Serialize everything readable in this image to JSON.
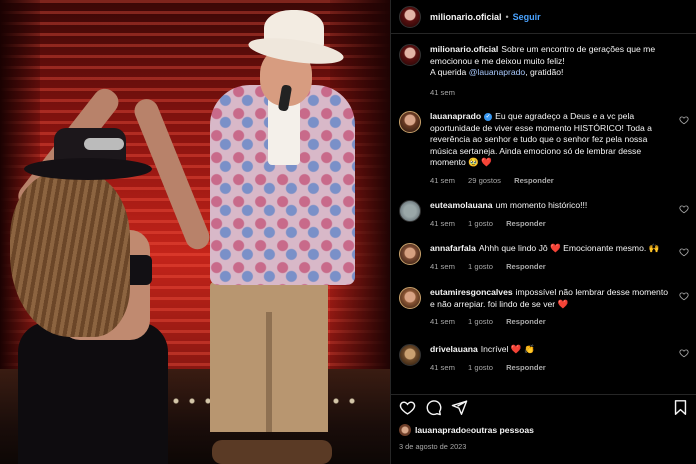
{
  "post": {
    "author": "milionario.oficial",
    "separator": "•",
    "follow_label": "Seguir",
    "caption_user": "milionario.oficial",
    "caption_text": "Sobre um encontro de gerações que me emocionou e me deixou muito feliz!",
    "caption_line2_prefix": "A querida ",
    "caption_mention": "@lauanaprado",
    "caption_line2_suffix": ", gratidão!",
    "caption_time": "41 sem"
  },
  "comments": [
    {
      "user": "lauanaprado",
      "verified": true,
      "text": "Eu que agradeço a Deus e a vc pela oportunidade de viver esse momento HISTÓRICO! Toda a reverência ao senhor e tudo que o senhor fez pela nossa música sertaneja. Ainda emociono só de lembrar desse momento 🥹 ❤️",
      "time": "41 sem",
      "likes": "29 gostos",
      "reply": "Responder"
    },
    {
      "user": "euteamolauana",
      "text": "um momento histórico!!!",
      "time": "41 sem",
      "likes": "1 gosto",
      "reply": "Responder"
    },
    {
      "user": "annafarfala",
      "text": "Ahhh que lindo Jô ❤️ Emocionante mesmo. 🙌",
      "time": "41 sem",
      "likes": "1 gosto",
      "reply": "Responder"
    },
    {
      "user": "eutamiresgoncalves",
      "text": "impossível não lembrar desse momento e não arrepiar. foi lindo de se ver ❤️",
      "time": "41 sem",
      "likes": "1 gosto",
      "reply": "Responder"
    },
    {
      "user": "drivelauana",
      "text": "Incrível ❤️ 👏",
      "time": "41 sem",
      "likes": "1 gosto",
      "reply": "Responder"
    }
  ],
  "likes_line": {
    "user": "lauanaprado",
    "connector": " e ",
    "others": "outras pessoas"
  },
  "date": "3 de agosto de 2023",
  "icons": {
    "like": "heart-icon",
    "comment": "comment-icon",
    "share": "share-icon",
    "save": "bookmark-icon"
  },
  "colors": {
    "follow": "#4aa3ff",
    "verified": "#3897f0",
    "heart": "#ff3040"
  }
}
